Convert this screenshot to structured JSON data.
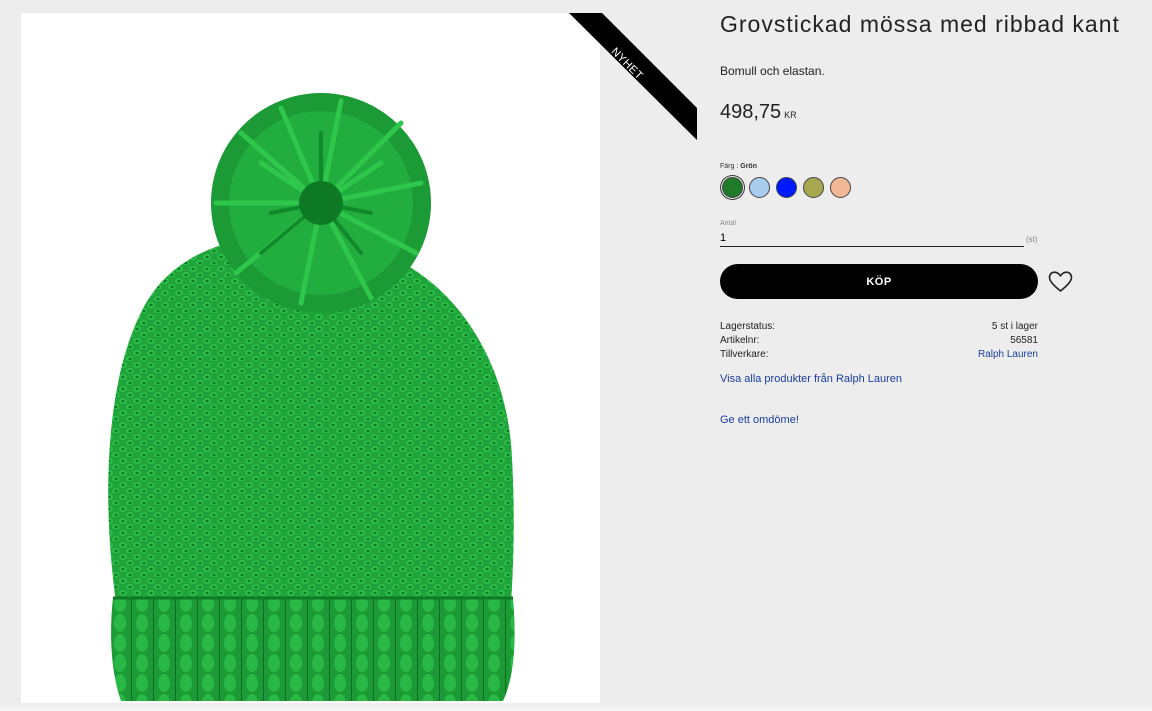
{
  "product": {
    "badge": "NYHET",
    "title": "Grovstickad mössa med ribbad kant",
    "description": "Bomull och elastan.",
    "price": "498,75",
    "currency": "KR",
    "image_icon": "knitted-beanie-with-pompom",
    "image_color": "#1fa33a"
  },
  "color": {
    "label": "Färg :",
    "selected_name": "Grön",
    "swatches": [
      {
        "name": "Grön",
        "hex": "#1f7a2a",
        "selected": true
      },
      {
        "name": "Ljusblå",
        "hex": "#a9cdee",
        "selected": false
      },
      {
        "name": "Blå",
        "hex": "#0019ff",
        "selected": false
      },
      {
        "name": "Oliv",
        "hex": "#a8a850",
        "selected": false
      },
      {
        "name": "Persika",
        "hex": "#f1b797",
        "selected": false
      }
    ]
  },
  "quantity": {
    "label": "Antal",
    "value": "1",
    "unit": "(st)"
  },
  "buy_button": "KÖP",
  "wishlist_icon": "heart-icon",
  "meta": {
    "stock_label": "Lagerstatus:",
    "stock_value": "5 st i lager",
    "article_label": "Artikelnr:",
    "article_value": "56581",
    "maker_label": "Tillverkare:",
    "maker_value": "Ralph Lauren"
  },
  "links": {
    "all_products": "Visa alla produkter från Ralph Lauren",
    "review": "Ge ett omdöme!"
  },
  "colors": {
    "link": "#1a3fa0",
    "button_bg": "#000000",
    "page_bg": "#ededed"
  }
}
